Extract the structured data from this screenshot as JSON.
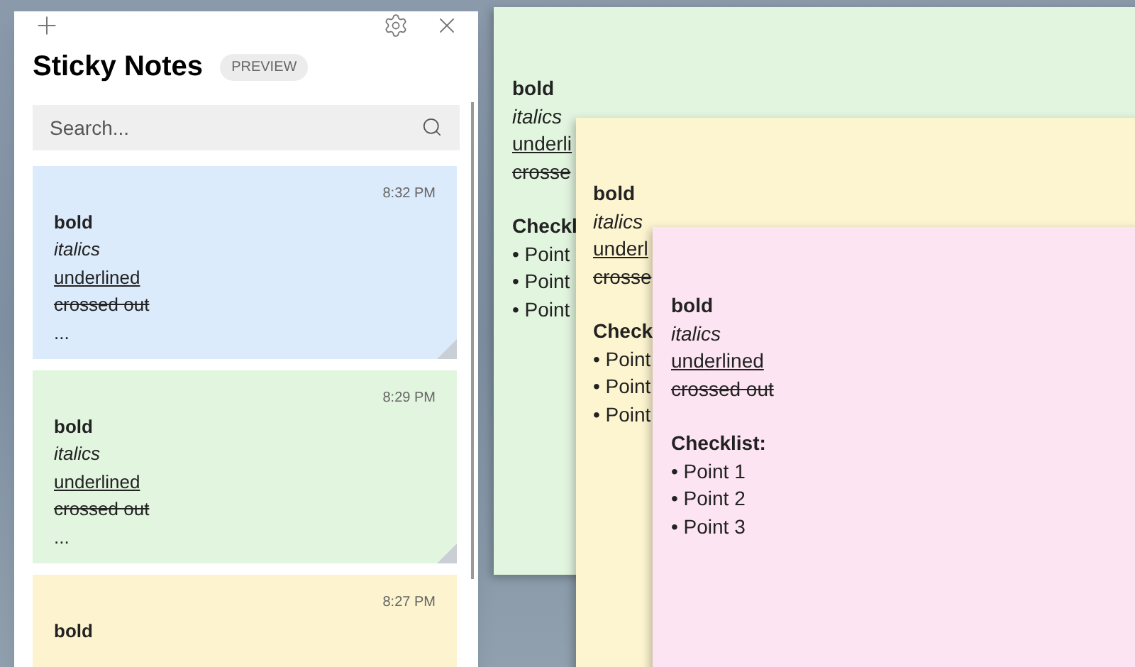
{
  "app": {
    "title": "Sticky Notes",
    "badge": "PREVIEW",
    "search": {
      "placeholder": "Search..."
    }
  },
  "note_list": [
    {
      "color": "#dcebfc",
      "time": "8:32 PM",
      "lines": [
        {
          "kind": "bold",
          "text": "bold"
        },
        {
          "kind": "italic",
          "text": "italics"
        },
        {
          "kind": "underline",
          "text": "underlined"
        },
        {
          "kind": "strike",
          "text": "crossed out"
        },
        {
          "kind": "plain",
          "text": "..."
        }
      ]
    },
    {
      "color": "#e2f6df",
      "time": "8:29 PM",
      "lines": [
        {
          "kind": "bold",
          "text": "bold"
        },
        {
          "kind": "italic",
          "text": "italics"
        },
        {
          "kind": "underline",
          "text": "underlined"
        },
        {
          "kind": "strike",
          "text": "crossed out"
        },
        {
          "kind": "plain",
          "text": "..."
        }
      ]
    },
    {
      "color": "#fdf3cf",
      "time": "8:27 PM",
      "lines": [
        {
          "kind": "bold",
          "text": "bold"
        }
      ]
    }
  ],
  "open_notes": [
    {
      "color": "#e2f6df",
      "lines": [
        {
          "kind": "bold",
          "text": "bold"
        },
        {
          "kind": "italic",
          "text": "italics"
        },
        {
          "kind": "underline",
          "text": "underli"
        },
        {
          "kind": "strike",
          "text": "crosse"
        }
      ],
      "heading": "Checkl",
      "points": [
        "• Point",
        "• Point",
        "• Point"
      ]
    },
    {
      "color": "#fdf4d0",
      "lines": [
        {
          "kind": "bold",
          "text": "bold"
        },
        {
          "kind": "italic",
          "text": "italics"
        },
        {
          "kind": "underline",
          "text": "underl"
        },
        {
          "kind": "strike",
          "text": "crosse"
        }
      ],
      "heading": "Check",
      "points": [
        "• Point",
        "• Point",
        "• Point"
      ]
    },
    {
      "color": "#fde4f2",
      "lines": [
        {
          "kind": "bold",
          "text": "bold"
        },
        {
          "kind": "italic",
          "text": "italics"
        },
        {
          "kind": "underline",
          "text": "underlined"
        },
        {
          "kind": "strike",
          "text": "crossed out"
        }
      ],
      "heading": "Checklist:",
      "points": [
        "• Point 1",
        "• Point 2",
        "• Point 3"
      ]
    }
  ]
}
